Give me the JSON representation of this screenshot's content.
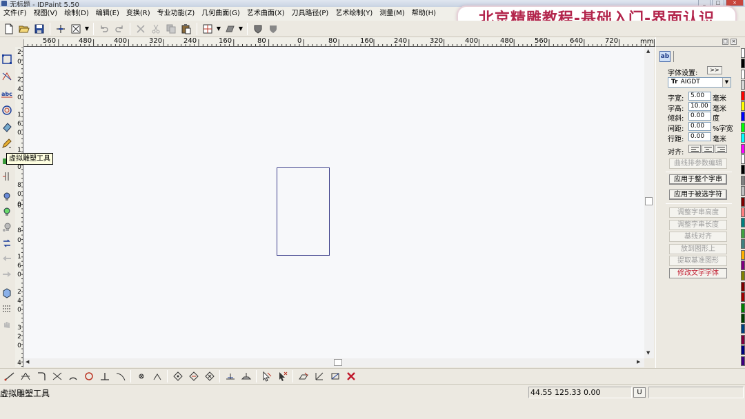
{
  "window": {
    "title": "无标题 - JDPaint 5.50"
  },
  "banner": {
    "text": "北京精雕教程-基础入门-界面认识"
  },
  "menu": [
    "文件(F)",
    "视图(V)",
    "绘制(D)",
    "编辑(E)",
    "变换(R)",
    "专业功能(Z)",
    "几何曲面(G)",
    "艺术曲面(X)",
    "刀具路径(P)",
    "艺术绘制(Y)",
    "测量(M)",
    "帮助(H)"
  ],
  "ruler": {
    "unit": "mm",
    "h_labels": [
      "560",
      "480",
      "400",
      "320",
      "240",
      "160",
      "80",
      "0",
      "80",
      "160",
      "240",
      "320",
      "400",
      "480",
      "560",
      "640",
      "720"
    ],
    "v_labels": [
      "2",
      "0",
      "2",
      "4",
      "0",
      "1",
      "6",
      "0",
      "1",
      "2",
      "0",
      "8",
      "0",
      "4",
      "0",
      "0",
      "4",
      "0",
      "8",
      "0",
      "1",
      "6",
      "0",
      "2",
      "4",
      "0",
      "3",
      "2",
      "0",
      "4"
    ]
  },
  "tooltip": {
    "text": "虚拟雕塑工具"
  },
  "panel": {
    "tab_label": "ab",
    "font_settings_label": "字体设置:",
    "font_expand_label": ">>",
    "font_name": "AIGDT",
    "font_glyph": "Tr",
    "fields": [
      {
        "label": "字宽:",
        "value": "5.00",
        "unit": "毫米"
      },
      {
        "label": "字高:",
        "value": "10.00",
        "unit": "毫米"
      },
      {
        "label": "倾斜:",
        "value": "0.00",
        "unit": "度"
      },
      {
        "label": "间距:",
        "value": "0.00",
        "unit": "%字宽"
      },
      {
        "label": "行距:",
        "value": "0.00",
        "unit": "毫米"
      }
    ],
    "align_label": "对齐:",
    "buttons": [
      {
        "label": "曲线排参数编辑",
        "state": "disabled"
      },
      {
        "label": "应用于整个字串",
        "state": "active"
      },
      {
        "label": "应用于被选字符",
        "state": "active"
      },
      {
        "label": "调整字串高度",
        "state": "disabled"
      },
      {
        "label": "调整字串长度",
        "state": "disabled"
      },
      {
        "label": "基线对齐",
        "state": "disabled"
      },
      {
        "label": "放到图形上",
        "state": "disabled"
      },
      {
        "label": "提取基准图形",
        "state": "disabled"
      },
      {
        "label": "修改文字字体",
        "state": "red"
      }
    ]
  },
  "palette": [
    "#ffffff",
    "#000000",
    "#ffffff",
    "#d8d8d8",
    "#ff0000",
    "#ffff00",
    "#0000ff",
    "#00ff00",
    "#00ffff",
    "#ff00ff",
    "#ffffff",
    "#000000",
    "#808080",
    "#c0c0c0",
    "#800000",
    "#ff8080",
    "#008080",
    "#40a040",
    "#408080",
    "#ffb000",
    "#800080",
    "#808000",
    "#800000",
    "#a00000",
    "#008000",
    "#004000",
    "#004080",
    "#800040",
    "#000080",
    "#400080"
  ],
  "status": {
    "message": "虚拟雕塑工具",
    "coords": "44.55 125.33 0.00",
    "mode": "U"
  }
}
